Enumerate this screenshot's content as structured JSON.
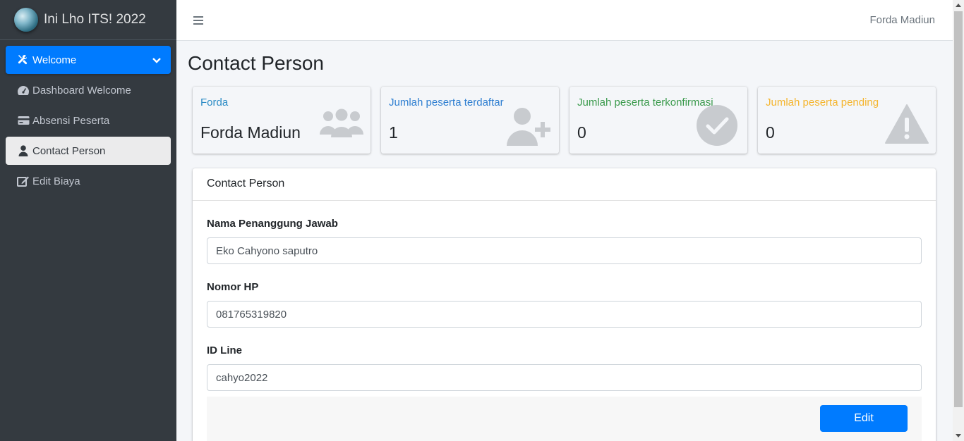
{
  "brand": {
    "title": "Ini Lho ITS! 2022"
  },
  "sidebar": {
    "items": [
      {
        "label": "Welcome"
      },
      {
        "label": "Dashboard Welcome"
      },
      {
        "label": "Absensi Peserta"
      },
      {
        "label": "Contact Person"
      },
      {
        "label": "Edit Biaya"
      }
    ]
  },
  "navbar": {
    "user": "Forda Madiun"
  },
  "page": {
    "title": "Contact Person"
  },
  "info_boxes": [
    {
      "label": "Forda",
      "value": "Forda Madiun",
      "color": "#2b8bc5",
      "icon": "users-icon"
    },
    {
      "label": "Jumlah peserta terdaftar",
      "value": "1",
      "color": "#2f7fd1",
      "icon": "user-plus-icon"
    },
    {
      "label": "Jumlah peserta terkonfirmasi",
      "value": "0",
      "color": "#3a9a4c",
      "icon": "check-circle-icon"
    },
    {
      "label": "Jumlah peserta pending",
      "value": "0",
      "color": "#f5b52e",
      "icon": "warning-icon"
    }
  ],
  "card": {
    "header": "Contact Person",
    "fields": [
      {
        "label": "Nama Penanggung Jawab",
        "value": "Eko Cahyono saputro"
      },
      {
        "label": "Nomor HP",
        "value": "081765319820"
      },
      {
        "label": "ID Line",
        "value": "cahyo2022"
      }
    ],
    "edit_label": "Edit"
  },
  "colors": {
    "primary": "#007bff",
    "sidebar": "#343a40"
  }
}
